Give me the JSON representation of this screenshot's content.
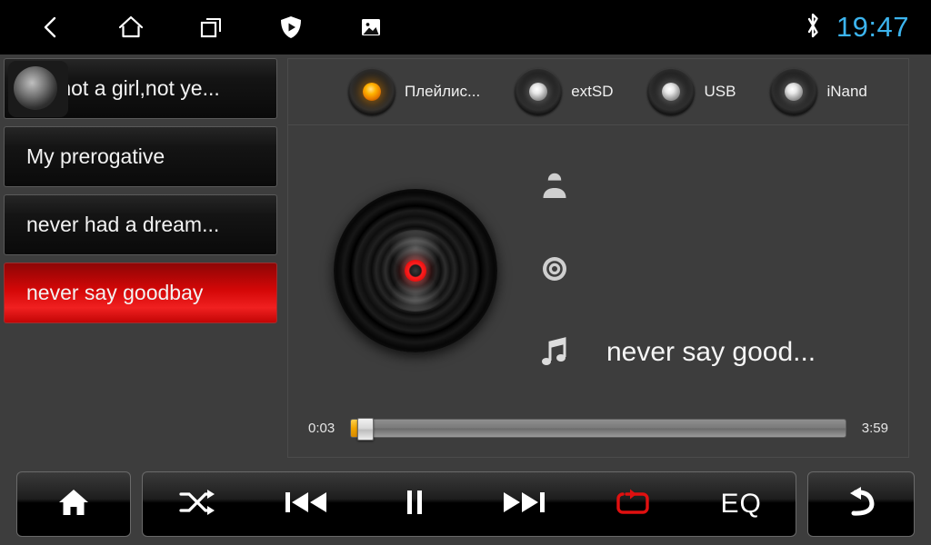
{
  "statusbar": {
    "icons": [
      {
        "name": "back-icon",
        "label": "Back"
      },
      {
        "name": "home-icon",
        "label": "Home"
      },
      {
        "name": "recents-icon",
        "label": "Recent apps"
      },
      {
        "name": "shield-play-icon",
        "label": "Protected media"
      },
      {
        "name": "gallery-icon",
        "label": "Gallery"
      }
    ],
    "bluetooth_icon": "bluetooth-icon",
    "clock": "19:47",
    "clock_color": "#3cb4ee"
  },
  "playlist": {
    "items": [
      {
        "title": "I'm not a girl,not ye...",
        "active": false,
        "pressed": true
      },
      {
        "title": "My prerogative",
        "active": false,
        "pressed": false
      },
      {
        "title": "never had a dream...",
        "active": false,
        "pressed": false
      },
      {
        "title": "never say goodbay",
        "active": true,
        "pressed": false
      }
    ],
    "active_color": "#d40707"
  },
  "sources": {
    "items": [
      {
        "label": "Плейлис...",
        "selected": true
      },
      {
        "label": "extSD",
        "selected": false
      },
      {
        "label": "USB",
        "selected": false
      },
      {
        "label": "iNand",
        "selected": false
      }
    ],
    "selected_color": "#ffb300"
  },
  "now_playing": {
    "album_art_icon": "vinyl-record-icon",
    "artist_icon": "person-icon",
    "artist": "",
    "album_icon": "disc-icon",
    "album": "",
    "title_icon": "music-note-icon",
    "title": "never say good...",
    "elapsed": "0:03",
    "duration": "3:59",
    "progress_percent": 1.5
  },
  "controls": {
    "home": {
      "name": "home-button",
      "icon": "home-filled-icon"
    },
    "shuffle": {
      "name": "shuffle-button",
      "icon": "shuffle-icon"
    },
    "previous": {
      "name": "previous-track-button",
      "icon": "previous-icon"
    },
    "playpause": {
      "name": "pause-button",
      "icon": "pause-icon"
    },
    "next": {
      "name": "next-track-button",
      "icon": "next-icon"
    },
    "repeat": {
      "name": "repeat-button",
      "icon": "repeat-icon",
      "active": true,
      "color": "#e01010"
    },
    "eq": {
      "name": "eq-button",
      "label": "EQ"
    },
    "back": {
      "name": "back-button",
      "icon": "return-arrow-icon"
    }
  }
}
